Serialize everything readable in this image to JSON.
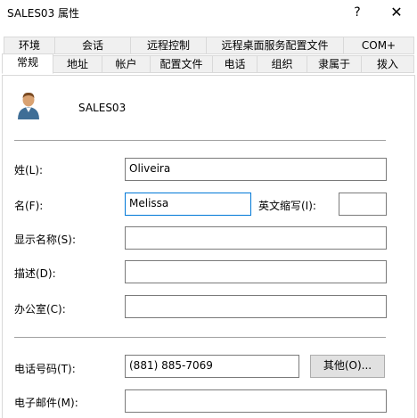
{
  "window": {
    "title": "SALES03 属性",
    "help_label": "?",
    "close_label": "✕"
  },
  "tabs": {
    "row1": [
      "环境",
      "会话",
      "远程控制",
      "远程桌面服务配置文件",
      "COM+"
    ],
    "row2": [
      "常规",
      "地址",
      "帐户",
      "配置文件",
      "电话",
      "组织",
      "隶属于",
      "拨入"
    ],
    "active": "常规"
  },
  "general": {
    "display_name": "SALES03",
    "avatar_icon": "user-icon",
    "fields": {
      "last_name": {
        "label": "姓(L):",
        "value": "Oliveira"
      },
      "first_name": {
        "label": "名(F):",
        "value": "Melissa"
      },
      "initials": {
        "label": "英文缩写(I):",
        "value": ""
      },
      "display": {
        "label": "显示名称(S):",
        "value": ""
      },
      "description": {
        "label": "描述(D):",
        "value": ""
      },
      "office": {
        "label": "办公室(C):",
        "value": ""
      },
      "phone": {
        "label": "电话号码(T):",
        "value": "(881) 885-7069"
      },
      "email": {
        "label": "电子邮件(M):",
        "value": ""
      }
    },
    "other_button": "其他(O)..."
  }
}
